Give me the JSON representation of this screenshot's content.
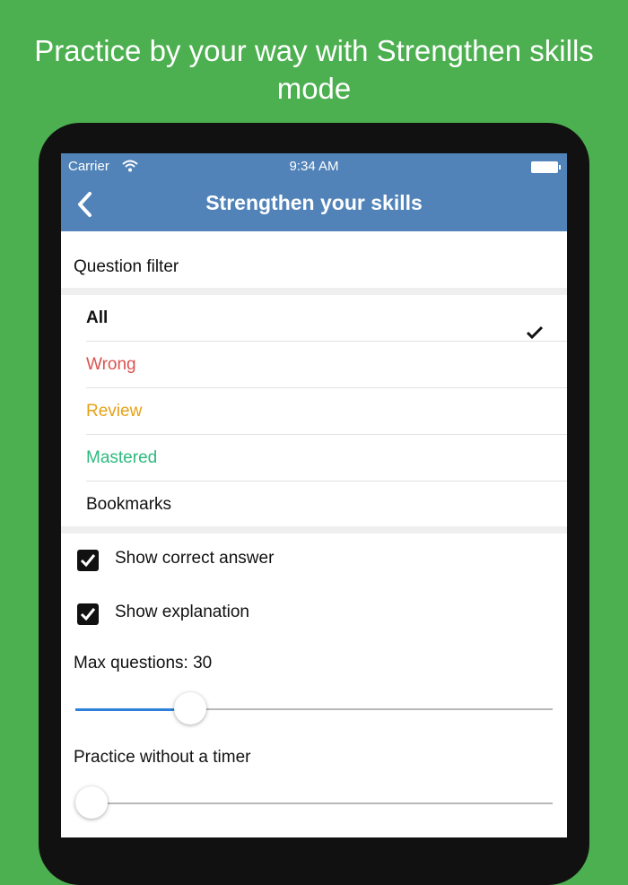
{
  "headline": "Practice by your way with Strengthen skills mode",
  "status_bar": {
    "carrier": "Carrier",
    "time": "9:34 AM"
  },
  "nav": {
    "title": "Strengthen your skills"
  },
  "question_filter": {
    "title": "Question filter",
    "options": [
      {
        "label": "All",
        "color": "#111111",
        "selected": true
      },
      {
        "label": "Wrong",
        "color": "#d9534f",
        "selected": false
      },
      {
        "label": "Review",
        "color": "#e6a117",
        "selected": false
      },
      {
        "label": "Mastered",
        "color": "#2dba7e",
        "selected": false
      },
      {
        "label": "Bookmarks",
        "color": "#111111",
        "selected": false
      }
    ]
  },
  "options": {
    "show_correct_answer": {
      "label": "Show correct answer",
      "checked": true
    },
    "show_explanation": {
      "label": "Show explanation",
      "checked": true
    }
  },
  "max_questions": {
    "label": "Max questions: 30",
    "slider_fraction": 0.24
  },
  "timer": {
    "label": "Practice without a timer",
    "slider_fraction": 0.0
  },
  "colors": {
    "background": "#4caf50",
    "navbar": "#5183b9",
    "slider_accent": "#2f80d8"
  }
}
